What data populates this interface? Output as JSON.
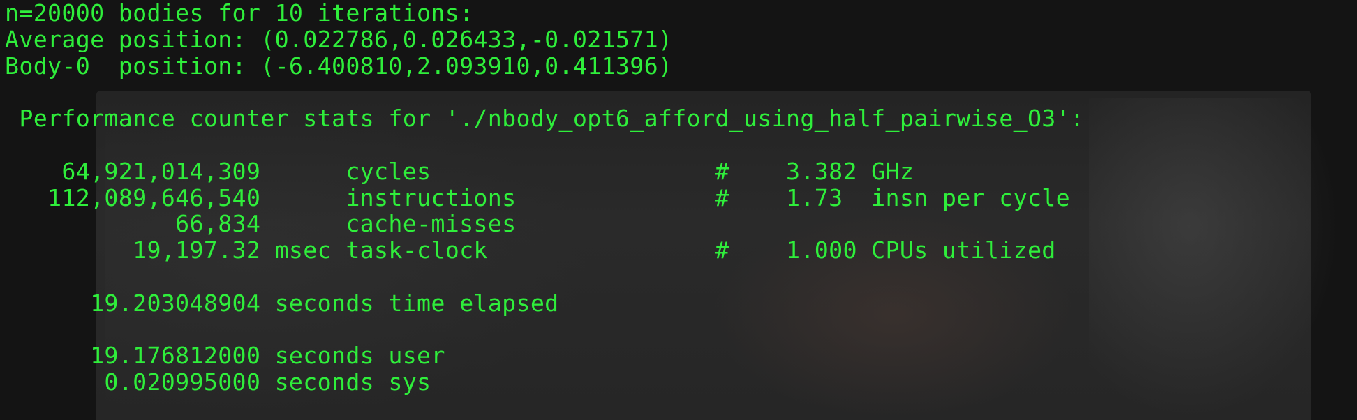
{
  "terminal": {
    "lines": [
      "n=20000 bodies for 10 iterations:",
      "Average position: (0.022786,0.026433,-0.021571)",
      "Body-0  position: (-6.400810,2.093910,0.411396)",
      "",
      " Performance counter stats for './nbody_opt6_afford_using_half_pairwise_O3':",
      "",
      "    64,921,014,309      cycles                    #    3.382 GHz",
      "   112,089,646,540      instructions              #    1.73  insn per cycle",
      "            66,834      cache-misses",
      "         19,197.32 msec task-clock                #    1.000 CPUs utilized",
      "",
      "      19.203048904 seconds time elapsed",
      "",
      "      19.176812000 seconds user",
      "       0.020995000 seconds sys"
    ]
  },
  "colors": {
    "text": "#2fee3b",
    "background": "#141414"
  }
}
